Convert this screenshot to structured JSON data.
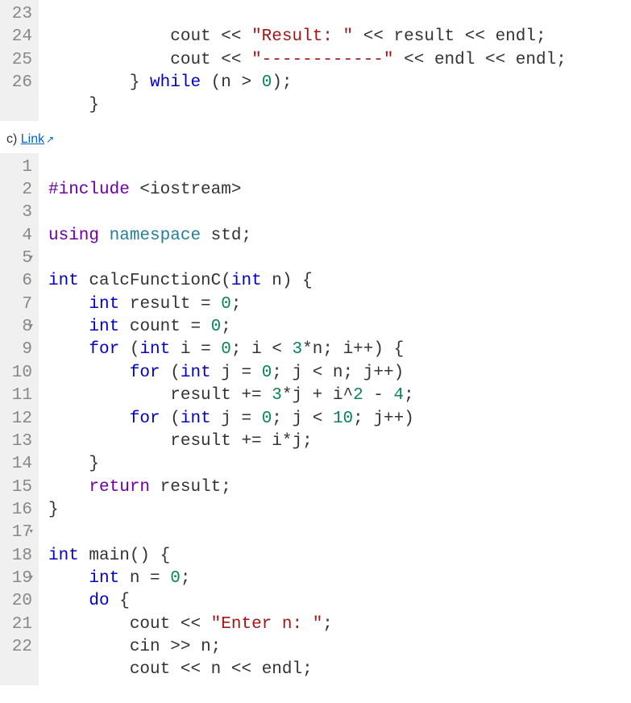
{
  "block1": {
    "lines": [
      {
        "n": 23,
        "fold": false
      },
      {
        "n": 24,
        "fold": false
      },
      {
        "n": 25,
        "fold": false
      },
      {
        "n": 26,
        "fold": false
      }
    ],
    "t": {
      "l23_indent": "            ",
      "l23_cout": "cout",
      "l23_out1": " << ",
      "l23_str": "\"Result: \"",
      "l23_out2": " << ",
      "l23_result": "result",
      "l23_out3": " << ",
      "l23_endl": "endl",
      "l23_semi": ";",
      "l24_indent": "            ",
      "l24_cout": "cout",
      "l24_out1": " << ",
      "l24_str": "\"------------\"",
      "l24_out2": " << ",
      "l24_endl1": "endl",
      "l24_out3": " << ",
      "l24_endl2": "endl",
      "l24_semi": ";",
      "l25_indent": "        ",
      "l25_brace": "} ",
      "l25_while": "while",
      "l25_open": " (",
      "l25_n": "n",
      "l25_gt": " > ",
      "l25_zero": "0",
      "l25_close": ");",
      "l26_indent": "    ",
      "l26_brace": "}"
    }
  },
  "caption": {
    "label": "c) ",
    "link_text": "Link"
  },
  "block2": {
    "lines": [
      {
        "n": 1,
        "fold": false
      },
      {
        "n": 2,
        "fold": false
      },
      {
        "n": 3,
        "fold": false
      },
      {
        "n": 4,
        "fold": false
      },
      {
        "n": 5,
        "fold": true
      },
      {
        "n": 6,
        "fold": false
      },
      {
        "n": 7,
        "fold": false
      },
      {
        "n": 8,
        "fold": true
      },
      {
        "n": 9,
        "fold": false
      },
      {
        "n": 10,
        "fold": false
      },
      {
        "n": 11,
        "fold": false
      },
      {
        "n": 12,
        "fold": false
      },
      {
        "n": 13,
        "fold": false
      },
      {
        "n": 14,
        "fold": false
      },
      {
        "n": 15,
        "fold": false
      },
      {
        "n": 16,
        "fold": false
      },
      {
        "n": 17,
        "fold": true
      },
      {
        "n": 18,
        "fold": false
      },
      {
        "n": 19,
        "fold": true
      },
      {
        "n": 20,
        "fold": false
      },
      {
        "n": 21,
        "fold": false
      },
      {
        "n": 22,
        "fold": false
      }
    ],
    "t": {
      "l1_include": "#include",
      "l1_header": " <iostream>",
      "l3_using": "using",
      "l3_namespace": "namespace",
      "l3_std": " std",
      "l3_semi": ";",
      "l5_int": "int",
      "l5_name": " calcFunctionC",
      "l5_open": "(",
      "l5_pint": "int",
      "l5_pn": " n",
      "l5_close": ") {",
      "l6_indent": "    ",
      "l6_int": "int",
      "l6_resultdecl": " result = ",
      "l6_zero": "0",
      "l6_semi": ";",
      "l7_indent": "    ",
      "l7_int": "int",
      "l7_countdecl": " count = ",
      "l7_zero": "0",
      "l7_semi": ";",
      "l8_indent": "    ",
      "l8_for": "for",
      "l8_open": " (",
      "l8_int": "int",
      "l8_ivar": " i = ",
      "l8_z": "0",
      "l8_semi1": "; ",
      "l8_cond1": "i < ",
      "l8_three": "3",
      "l8_mul": "*n",
      "l8_semi2": "; ",
      "l8_inc": "i++",
      "l8_close": ") {",
      "l9_indent": "        ",
      "l9_for": "for",
      "l9_open": " (",
      "l9_int": "int",
      "l9_jvar": " j = ",
      "l9_z": "0",
      "l9_semi1": "; ",
      "l9_cond": "j < n",
      "l9_semi2": "; ",
      "l9_inc": "j++",
      "l9_close": ")",
      "l10_indent": "            ",
      "l10_res": "result += ",
      "l10_three": "3",
      "l10_mid1": "*j + i^",
      "l10_two": "2",
      "l10_mid2": " - ",
      "l10_four": "4",
      "l10_semi": ";",
      "l11_indent": "        ",
      "l11_for": "for",
      "l11_open": " (",
      "l11_int": "int",
      "l11_jvar": " j = ",
      "l11_z": "0",
      "l11_semi1": "; ",
      "l11_cond": "j < ",
      "l11_ten": "10",
      "l11_semi2": "; ",
      "l11_inc": "j++",
      "l11_close": ")",
      "l12_indent": "            ",
      "l12_body": "result += i*j",
      "l12_semi": ";",
      "l13_indent": "    ",
      "l13_brace": "}",
      "l14_indent": "    ",
      "l14_return": "return",
      "l14_res": " result",
      "l14_semi": ";",
      "l15_brace": "}",
      "l17_int": "int",
      "l17_main": " main",
      "l17_parens": "() {",
      "l18_indent": "    ",
      "l18_int": "int",
      "l18_ndecl": " n = ",
      "l18_zero": "0",
      "l18_semi": ";",
      "l19_indent": "    ",
      "l19_do": "do",
      "l19_brace": " {",
      "l20_indent": "        ",
      "l20_cout": "cout",
      "l20_out": " << ",
      "l20_str": "\"Enter n: \"",
      "l20_semi": ";",
      "l21_indent": "        ",
      "l21_cin": "cin",
      "l21_in": " >> ",
      "l21_n": "n",
      "l21_semi": ";",
      "l22_indent": "        ",
      "l22_cout": "cout",
      "l22_out1": " << ",
      "l22_n": "n",
      "l22_out2": " << ",
      "l22_endl": "endl",
      "l22_semi": ";"
    }
  }
}
